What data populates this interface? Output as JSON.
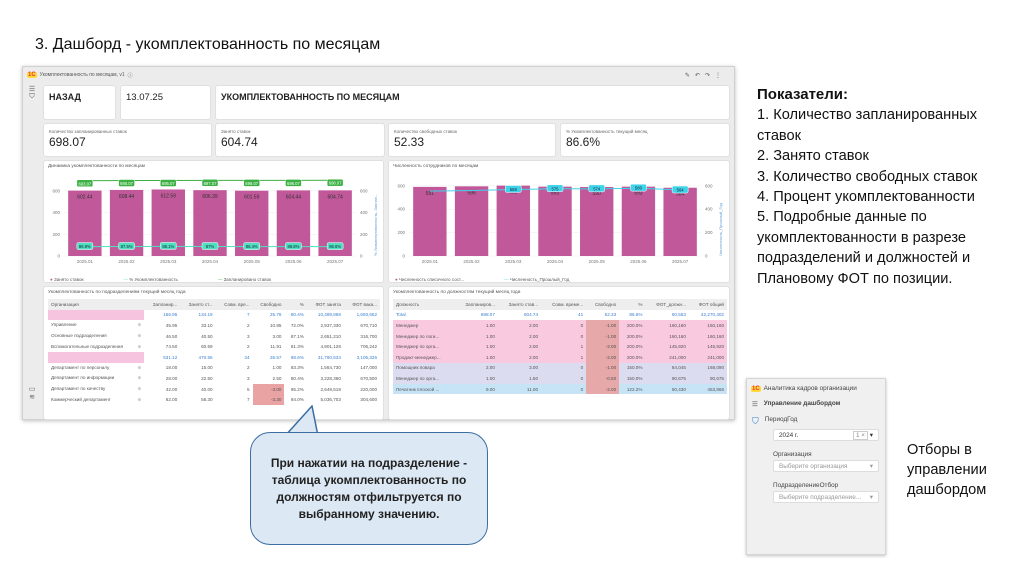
{
  "slide_title": "3. Дашборд - укомплектованность по месяцам",
  "dashboard": {
    "window_title": "Укомплектованность по месяцам, v1",
    "back_label": "НАЗАД",
    "date": "13.07.25",
    "page_title": "УКОМПЛЕКТОВАННОСТЬ ПО МЕСЯЦАМ",
    "kpis": [
      {
        "label": "Количество запланированных ставок",
        "value": "698.07"
      },
      {
        "label": "Занято ставок",
        "value": "604.74"
      },
      {
        "label": "Количество свободных ставок",
        "value": "52.33"
      },
      {
        "label": "% Укомплектованность текущий месяц",
        "value": "86.6%"
      }
    ],
    "left_table": {
      "title": "Укомплектованность по подразделениям текущий месяц года",
      "headers": [
        "Организация",
        "Запланир...",
        "Занято ст...",
        "Совм. вре...",
        "Свободно",
        "%",
        "ФОТ занята",
        "ФОТ вака..."
      ],
      "rows": [
        {
          "cells": [
            "",
            "166.95",
            "134.19",
            "7",
            "25.76",
            "80.4%",
            "10,489,868",
            "1,693,652"
          ],
          "type": "org"
        },
        {
          "cells": [
            "Управление",
            "45.95",
            "33.10",
            "2",
            "10.85",
            "72.0%",
            "2,937,330",
            "670,710"
          ]
        },
        {
          "cells": [
            "Основные подразделения",
            "46.50",
            "40.50",
            "3",
            "3.00",
            "87.1%",
            "2,651,210",
            "316,700"
          ]
        },
        {
          "cells": [
            "Вспомогательные подразделения",
            "74.50",
            "60.59",
            "2",
            "11.91",
            "81.3%",
            "4,901,128",
            "706,242"
          ]
        },
        {
          "cells": [
            "",
            "531.12",
            "470.55",
            "34",
            "26.57",
            "88.6%",
            "31,780,534",
            "3,105,326"
          ],
          "type": "org"
        },
        {
          "cells": [
            "Департамент по персоналу",
            "18.00",
            "15.00",
            "2",
            "1.00",
            "83.3%",
            "1,564,730",
            "147,000"
          ]
        },
        {
          "cells": [
            "Департамент по информации",
            "28.00",
            "22.50",
            "3",
            "2.50",
            "80.4%",
            "3,228,360",
            "670,500"
          ]
        },
        {
          "cells": [
            "Департамент по качеству",
            "42.00",
            "40.00",
            "5",
            "-3.00",
            "95.2%",
            "2,649,519",
            "220,000"
          ],
          "neg": true
        },
        {
          "cells": [
            "Коммерческий департамент",
            "62.00",
            "58.30",
            "7",
            "-3.30",
            "94.0%",
            "5,036,703",
            "304,600"
          ],
          "neg": true
        }
      ]
    },
    "right_table": {
      "title": "Укомплектованность по должностям текущий месяц года",
      "headers": [
        "Должность",
        "Запланиров...",
        "Занято став...",
        "Совм. време...",
        "Свободно",
        "%",
        "ФОТ_должн...",
        "ФОТ общий"
      ],
      "rows": [
        {
          "cells": [
            "Total",
            "698.07",
            "604.74",
            "41",
            "52.33",
            "86.6%",
            "60,553",
            "42,270,402"
          ],
          "bg": "#ffffff"
        },
        {
          "cells": [
            "Менеджер",
            "1.00",
            "2.00",
            "0",
            "-1.00",
            "200.0%",
            "160,160",
            "160,160"
          ],
          "bg": "#f9c9e0"
        },
        {
          "cells": [
            "Менеджер по логи...",
            "1.00",
            "2.00",
            "0",
            "-1.00",
            "200.0%",
            "160,160",
            "160,160"
          ],
          "bg": "#f9c9e0"
        },
        {
          "cells": [
            "Менеджер по орга...",
            "1.00",
            "2.00",
            "1",
            "-2.00",
            "200.0%",
            "145,920",
            "145,920"
          ],
          "bg": "#f9c9e0"
        },
        {
          "cells": [
            "Продакт-менеджер...",
            "1.00",
            "2.00",
            "1",
            "-2.00",
            "200.0%",
            "241,000",
            "241,000"
          ],
          "bg": "#f9c9e0"
        },
        {
          "cells": [
            "Помощник повара",
            "2.00",
            "3.00",
            "0",
            "-1.00",
            "150.0%",
            "84,045",
            "168,090"
          ],
          "bg": "#dcdcf0"
        },
        {
          "cells": [
            "Менеджер по орга...",
            "1.00",
            "1.50",
            "0",
            "-0.50",
            "150.0%",
            "90,675",
            "90,675"
          ],
          "bg": "#dcdcf0"
        },
        {
          "cells": [
            "Печатник плоской ...",
            "9.00",
            "11.00",
            "0",
            "-2.00",
            "122.2%",
            "50,430",
            "453,866"
          ],
          "bg": "#c7e4f7"
        }
      ]
    }
  },
  "chart_data": [
    {
      "type": "bar",
      "title": "Динамика укомплектованности по месяцам",
      "categories": [
        "2025.01",
        "2025.02",
        "2025.03",
        "2025.04",
        "2025.05",
        "2025.06",
        "2025.07"
      ],
      "series": [
        {
          "name": "Занято ставок",
          "type": "bar",
          "values": [
            602.44,
            608.44,
            612.59,
            606.39,
            601.59,
            604.44,
            604.74
          ],
          "labels": [
            "602.44",
            "608.44",
            "612.59",
            "606.39",
            "601.59",
            "604.44",
            "604.74"
          ],
          "color": "#c0589a"
        },
        {
          "name": "% Укомплектованность",
          "type": "line",
          "values": [
            86.9,
            87.5,
            88.1,
            87,
            86.4,
            86.8,
            86.6
          ],
          "labels": [
            "86.9%",
            "87.5%",
            "88.1%",
            "87%",
            "86.4%",
            "86.8%",
            "86.6%"
          ],
          "color": "#4fe0c0"
        },
        {
          "name": "Запланировано ставок",
          "type": "line",
          "values": [
            693.07,
            695.07,
            695.07,
            697.07,
            696.07,
            696.07,
            698.07
          ],
          "labels": [
            "693.07",
            "695.07",
            "695.07",
            "697.07",
            "696.07",
            "696.07",
            "698.07"
          ],
          "color": "#3cb043"
        }
      ],
      "yticks": [
        "0",
        "200",
        "400",
        "600"
      ],
      "ylim": [
        0,
        700
      ],
      "right_ylabel": "% Укомплектованность, Заплан..."
    },
    {
      "type": "bar",
      "title": "Численность сотрудников по месяцам",
      "categories": [
        "2025.01",
        "2025.02",
        "2025.03",
        "2025.04",
        "2025.05",
        "2025.06",
        "2025.07"
      ],
      "series": [
        {
          "name": "Численность списочного сост...",
          "type": "bar",
          "values": [
            591,
            596,
            602,
            593,
            590,
            593,
            584
          ],
          "labels": [
            "591",
            "596",
            "602",
            "593",
            "590",
            "593",
            "584"
          ],
          "color": "#c0589a"
        },
        {
          "name": "Численность_Прошлый_Год",
          "type": "line",
          "values": [
            555,
            560,
            569,
            575,
            574,
            580,
            564
          ],
          "labels": [
            "",
            "",
            "569",
            "575",
            "574",
            "580",
            "564"
          ],
          "color": "#3fd3ea"
        }
      ],
      "yticks": [
        "0",
        "200",
        "400",
        "600"
      ],
      "ylim": [
        0,
        650
      ],
      "right_ylabel": "Численность_Прошлый_Год"
    }
  ],
  "indicators": {
    "title": "Показатели:",
    "items": [
      "1. Количество запланированных ставок",
      "2. Занято ставок",
      "3. Количество свободных ставок",
      "4. Процент укомплектованности",
      "5. Подробные данные по укомплектованности в разрезе подразделений и должностей и Плановому ФОТ по позиции."
    ]
  },
  "callout": "При нажатии на подразделение - таблица укомплектованность по должностям отфильтруется по выбранному значению.",
  "filters": {
    "app_title": "Аналитика кадров организации",
    "section": "Управление дашбордом",
    "period_label": "ПериодГод",
    "period_value": "2024 г.",
    "period_count": "1 ×",
    "org_label": "Организация",
    "org_placeholder": "Выберите организация",
    "dept_label": "ПодразделениеОтбор",
    "dept_placeholder": "Выберите подразделение..."
  },
  "side_note": "Отборы в управлении дашбордом"
}
